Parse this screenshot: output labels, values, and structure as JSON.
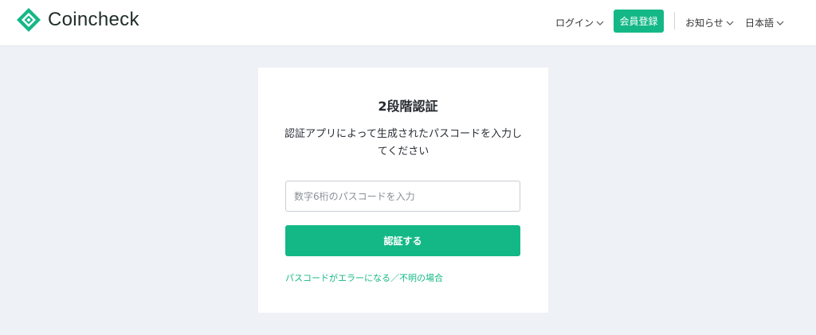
{
  "brand": {
    "name": "Coincheck",
    "color": "#14b886"
  },
  "header": {
    "login_label": "ログイン",
    "signup_label": "会員登録",
    "news_label": "お知らせ",
    "language_label": "日本語"
  },
  "icons": {
    "logo": "coincheck-logo-icon",
    "dropdown": "chevron-down-icon"
  },
  "auth": {
    "title": "2段階認証",
    "description": "認証アプリによって生成されたパスコードを入力してください",
    "input_value": "",
    "input_placeholder": "数字6桁のパスコードを入力",
    "submit_label": "認証する",
    "help_link": "パスコードがエラーになる／不明の場合"
  }
}
